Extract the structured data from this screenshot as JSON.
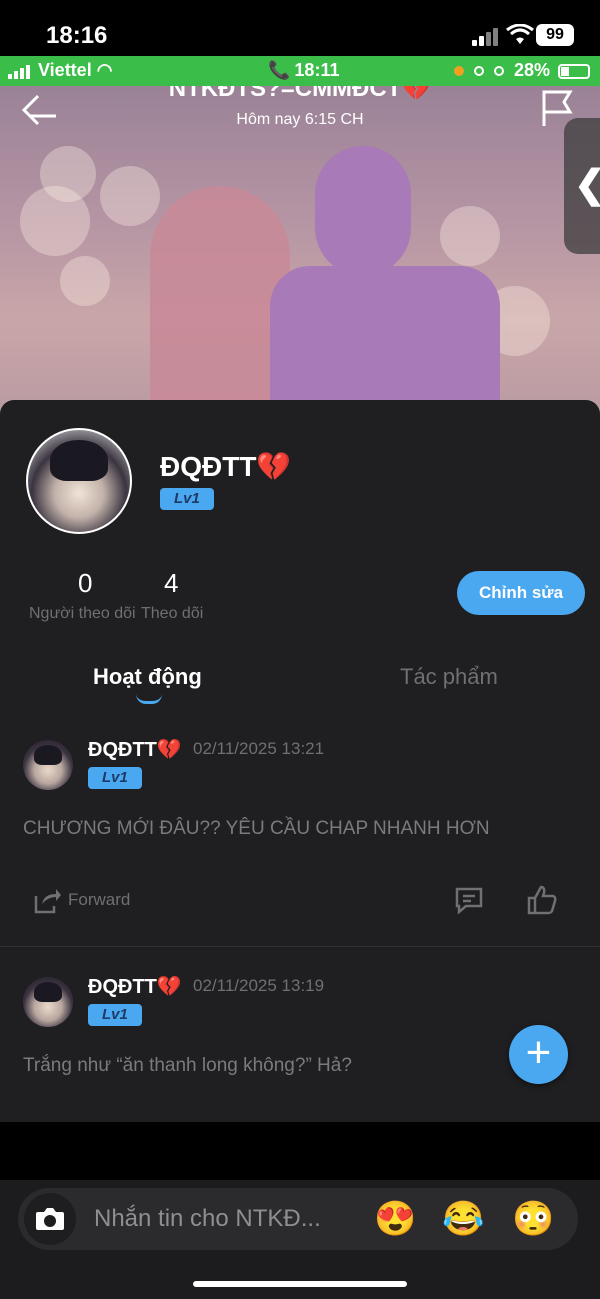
{
  "ios_status": {
    "time": "18:16",
    "battery": "99"
  },
  "inner_status": {
    "carrier": "Viettel",
    "time": "18:11",
    "battery": "28%"
  },
  "header": {
    "title": "NTKĐTS?=CMMĐCT💔",
    "subtitle": "Hôm nay 6:15 CH"
  },
  "profile": {
    "name": "ĐQĐTT💔",
    "level": "Lv1",
    "followers_count": "0",
    "followers_label": "Người theo dõi",
    "following_count": "4",
    "following_label": "Theo dõi",
    "edit_label": "Chỉnh sửa"
  },
  "tabs": [
    {
      "label": "Hoạt động",
      "active": true
    },
    {
      "label": "Tác phẩm",
      "active": false
    }
  ],
  "posts": [
    {
      "author": "ĐQĐTT💔",
      "level": "Lv1",
      "timestamp": "02/11/2025 13:21",
      "text": "CHƯƠNG MỚI ĐÂU?? YÊU CẦU CHAP NHANH HƠN",
      "forward_label": "Forward"
    },
    {
      "author": "ĐQĐTT💔",
      "level": "Lv1",
      "timestamp": "02/11/2025 13:19",
      "text": "Trắng như “ăn thanh long không?” Hả?"
    }
  ],
  "composer": {
    "placeholder": "Nhắn tin cho NTKĐ...",
    "emojis": [
      "😍",
      "😂",
      "😳"
    ]
  },
  "colors": {
    "accent": "#4aa8f0",
    "card_bg": "#1f1f21",
    "green_bar": "#3bbd4a"
  }
}
